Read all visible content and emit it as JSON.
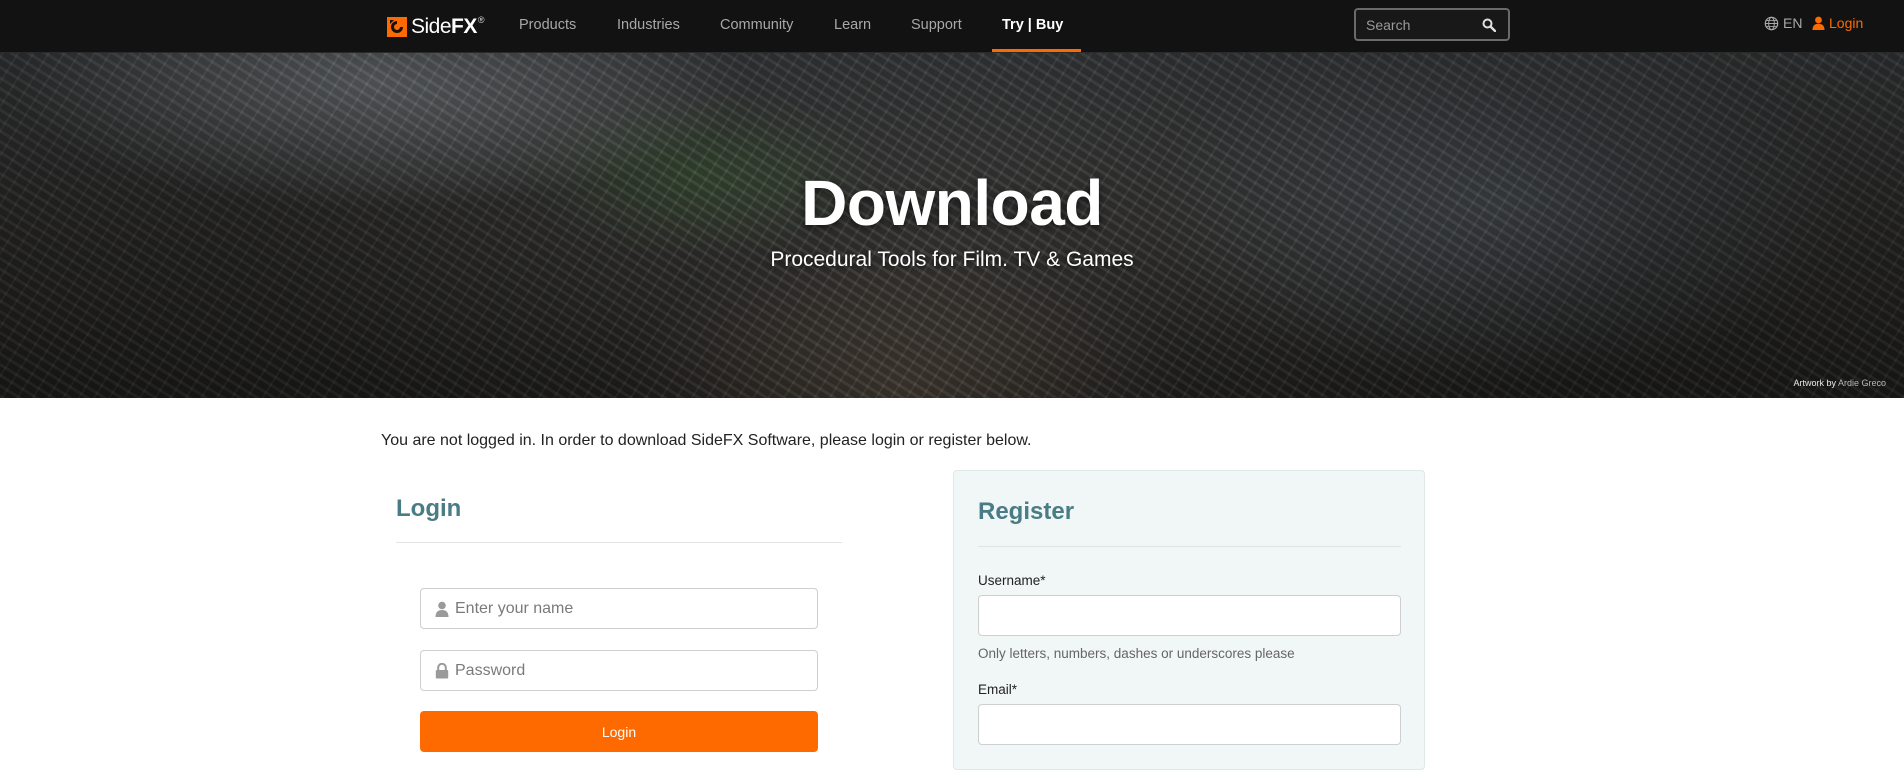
{
  "brand": {
    "name_side": "Side",
    "name_fx": "FX",
    "registered_mark": "®",
    "accent": "#ff6a00"
  },
  "nav": {
    "items": [
      {
        "label": "Products"
      },
      {
        "label": "Industries"
      },
      {
        "label": "Community"
      },
      {
        "label": "Learn"
      },
      {
        "label": "Support"
      },
      {
        "label": "Try | Buy",
        "active": true
      }
    ],
    "search_placeholder": "Search",
    "language": "EN",
    "login_label": "Login"
  },
  "hero": {
    "title": "Download",
    "subtitle": "Procedural Tools for Film. TV & Games",
    "credit_prefix": "Artwork by",
    "credit_artist": "Ardie Greco"
  },
  "notice": "You are not logged in. In order to download SideFX Software, please login or register below.",
  "login_panel": {
    "title": "Login",
    "name_placeholder": "Enter your name",
    "password_placeholder": "Password",
    "submit_label": "Login"
  },
  "register_panel": {
    "title": "Register",
    "username_label": "Username*",
    "username_help": "Only letters, numbers, dashes or underscores please",
    "email_label": "Email*"
  },
  "colors": {
    "heading": "#4a7c86",
    "button": "#ff6a00",
    "nav_bg": "#121212"
  }
}
